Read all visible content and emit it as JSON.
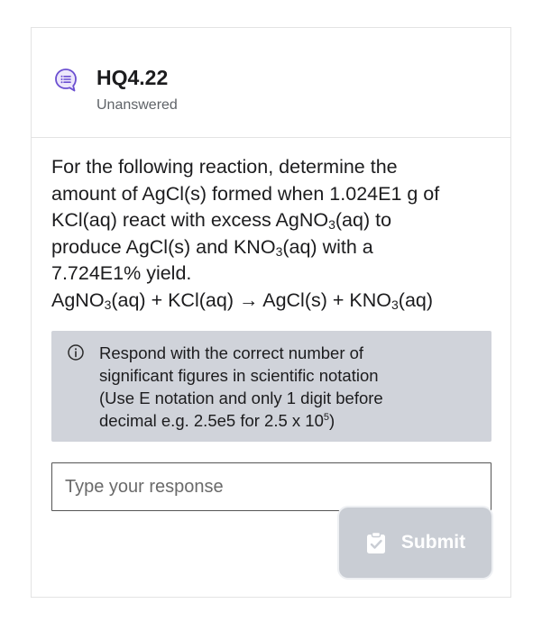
{
  "question": {
    "title": "HQ4.22",
    "status": "Unanswered",
    "icon": "chat-bubble-list-icon",
    "prompt": {
      "line1": "For the following reaction, determine the",
      "line2": "amount of AgCl(s) formed when 1.024E1 g of",
      "line3_a": "KCl(aq) react with excess AgNO",
      "line3_sub": "3",
      "line3_b": "(aq) to",
      "line4_a": "produce AgCl(s) and KNO",
      "line4_sub": "3",
      "line4_b": "(aq) with a",
      "line5": "7.724E1% yield.",
      "eq_a": "AgNO",
      "eq_sub1": "3",
      "eq_b": "(aq) + KCl(aq) → AgCl(s) + KNO",
      "eq_sub2": "3",
      "eq_c": "(aq)"
    }
  },
  "hint": {
    "icon": "info-icon",
    "line1": "Respond with the correct number of",
    "line2": "significant figures in scientific notation",
    "line3": "(Use E notation and only 1 digit before",
    "line4_a": "decimal e.g. 2.5e5 for 2.5 x 10",
    "line4_sup": "5",
    "line4_b": ")"
  },
  "response": {
    "placeholder": "Type your response",
    "value": ""
  },
  "submit": {
    "label": "Submit",
    "icon": "clipboard-check-icon",
    "enabled": false
  },
  "colors": {
    "accent": "#6b4fd1",
    "hint_bg": "#d0d3da",
    "submit_bg_disabled": "#c9cdd4"
  }
}
